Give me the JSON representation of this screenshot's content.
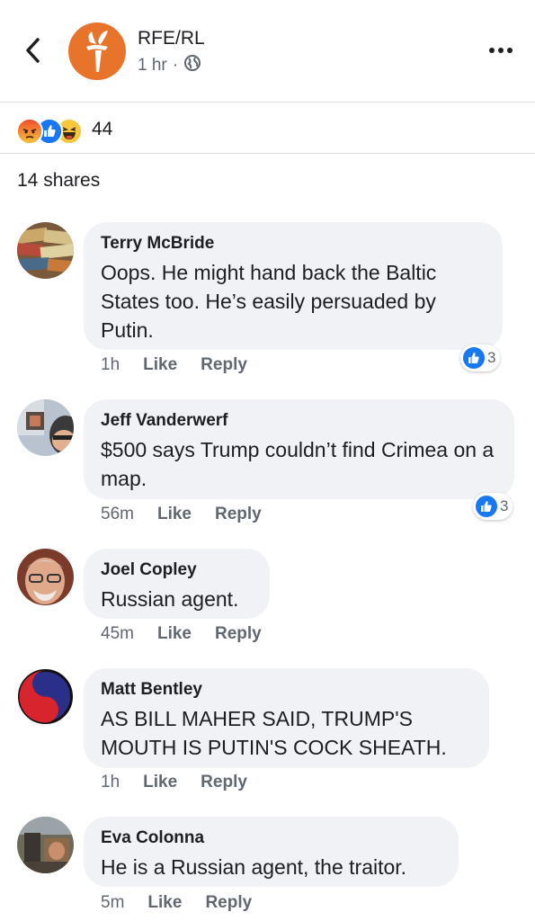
{
  "header": {
    "page_name": "RFE/RL",
    "time": "1 hr",
    "separator": "·"
  },
  "colors": {
    "brand": "#e8742c",
    "like_blue": "#1877f2",
    "bubble": "#f0f2f5",
    "muted": "#606770"
  },
  "reactions": {
    "icons": [
      "angry-reaction-icon",
      "like-reaction-icon",
      "haha-reaction-icon"
    ],
    "count": "44"
  },
  "shares": "14 shares",
  "comments": [
    {
      "author": "Terry McBride",
      "text": "Oops.  He might hand back the Baltic States too.  He’s easily persuaded by Putin.",
      "time": "1h",
      "like": "Like",
      "reply": "Reply",
      "likes": "3"
    },
    {
      "author": "Jeff Vanderwerf",
      "text": "$500 says Trump couldn’t find Crimea on a map.",
      "time": "56m",
      "like": "Like",
      "reply": "Reply",
      "likes": "3"
    },
    {
      "author": "Joel Copley",
      "text": "Russian agent.",
      "time": "45m",
      "like": "Like",
      "reply": "Reply"
    },
    {
      "author": "Matt Bentley",
      "text": "AS BILL MAHER SAID, TRUMP'S MOUTH IS PUTIN'S COCK SHEATH.",
      "time": "1h",
      "like": "Like",
      "reply": "Reply"
    },
    {
      "author": "Eva Colonna",
      "text": "He is a Russian agent, the traitor.",
      "time": "5m",
      "like": "Like",
      "reply": "Reply"
    }
  ]
}
